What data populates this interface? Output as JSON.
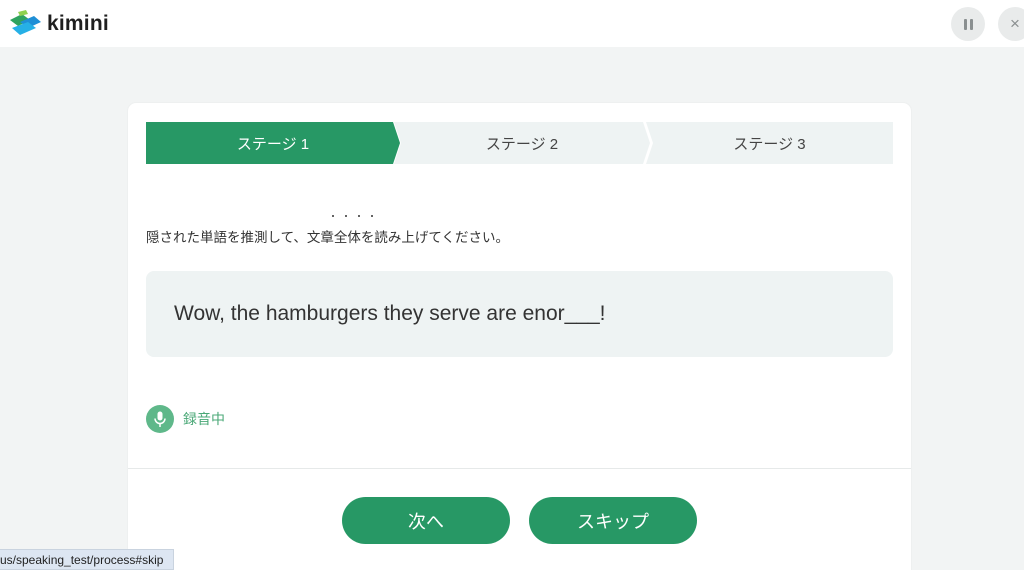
{
  "app": {
    "name": "kimini"
  },
  "header": {
    "close_symbol": "×"
  },
  "stages": [
    {
      "label": "ステージ 1",
      "active": true
    },
    {
      "label": "ステージ 2",
      "active": false
    },
    {
      "label": "ステージ 3",
      "active": false
    }
  ],
  "instruction": "隠された単語を推測して、文章全体を読み上げてください。",
  "sentence": "Wow, the hamburgers they serve are enor___!",
  "recording": {
    "label": "録音中",
    "icon": "microphone-icon"
  },
  "buttons": {
    "next_label": "次へ",
    "skip_label": "スキップ"
  },
  "status_url": "us/speaking_test/process#skip",
  "colors": {
    "accent": "#279865",
    "accent_light": "#5fb88a",
    "panel": "#eef3f3",
    "background": "#f2f4f4"
  }
}
